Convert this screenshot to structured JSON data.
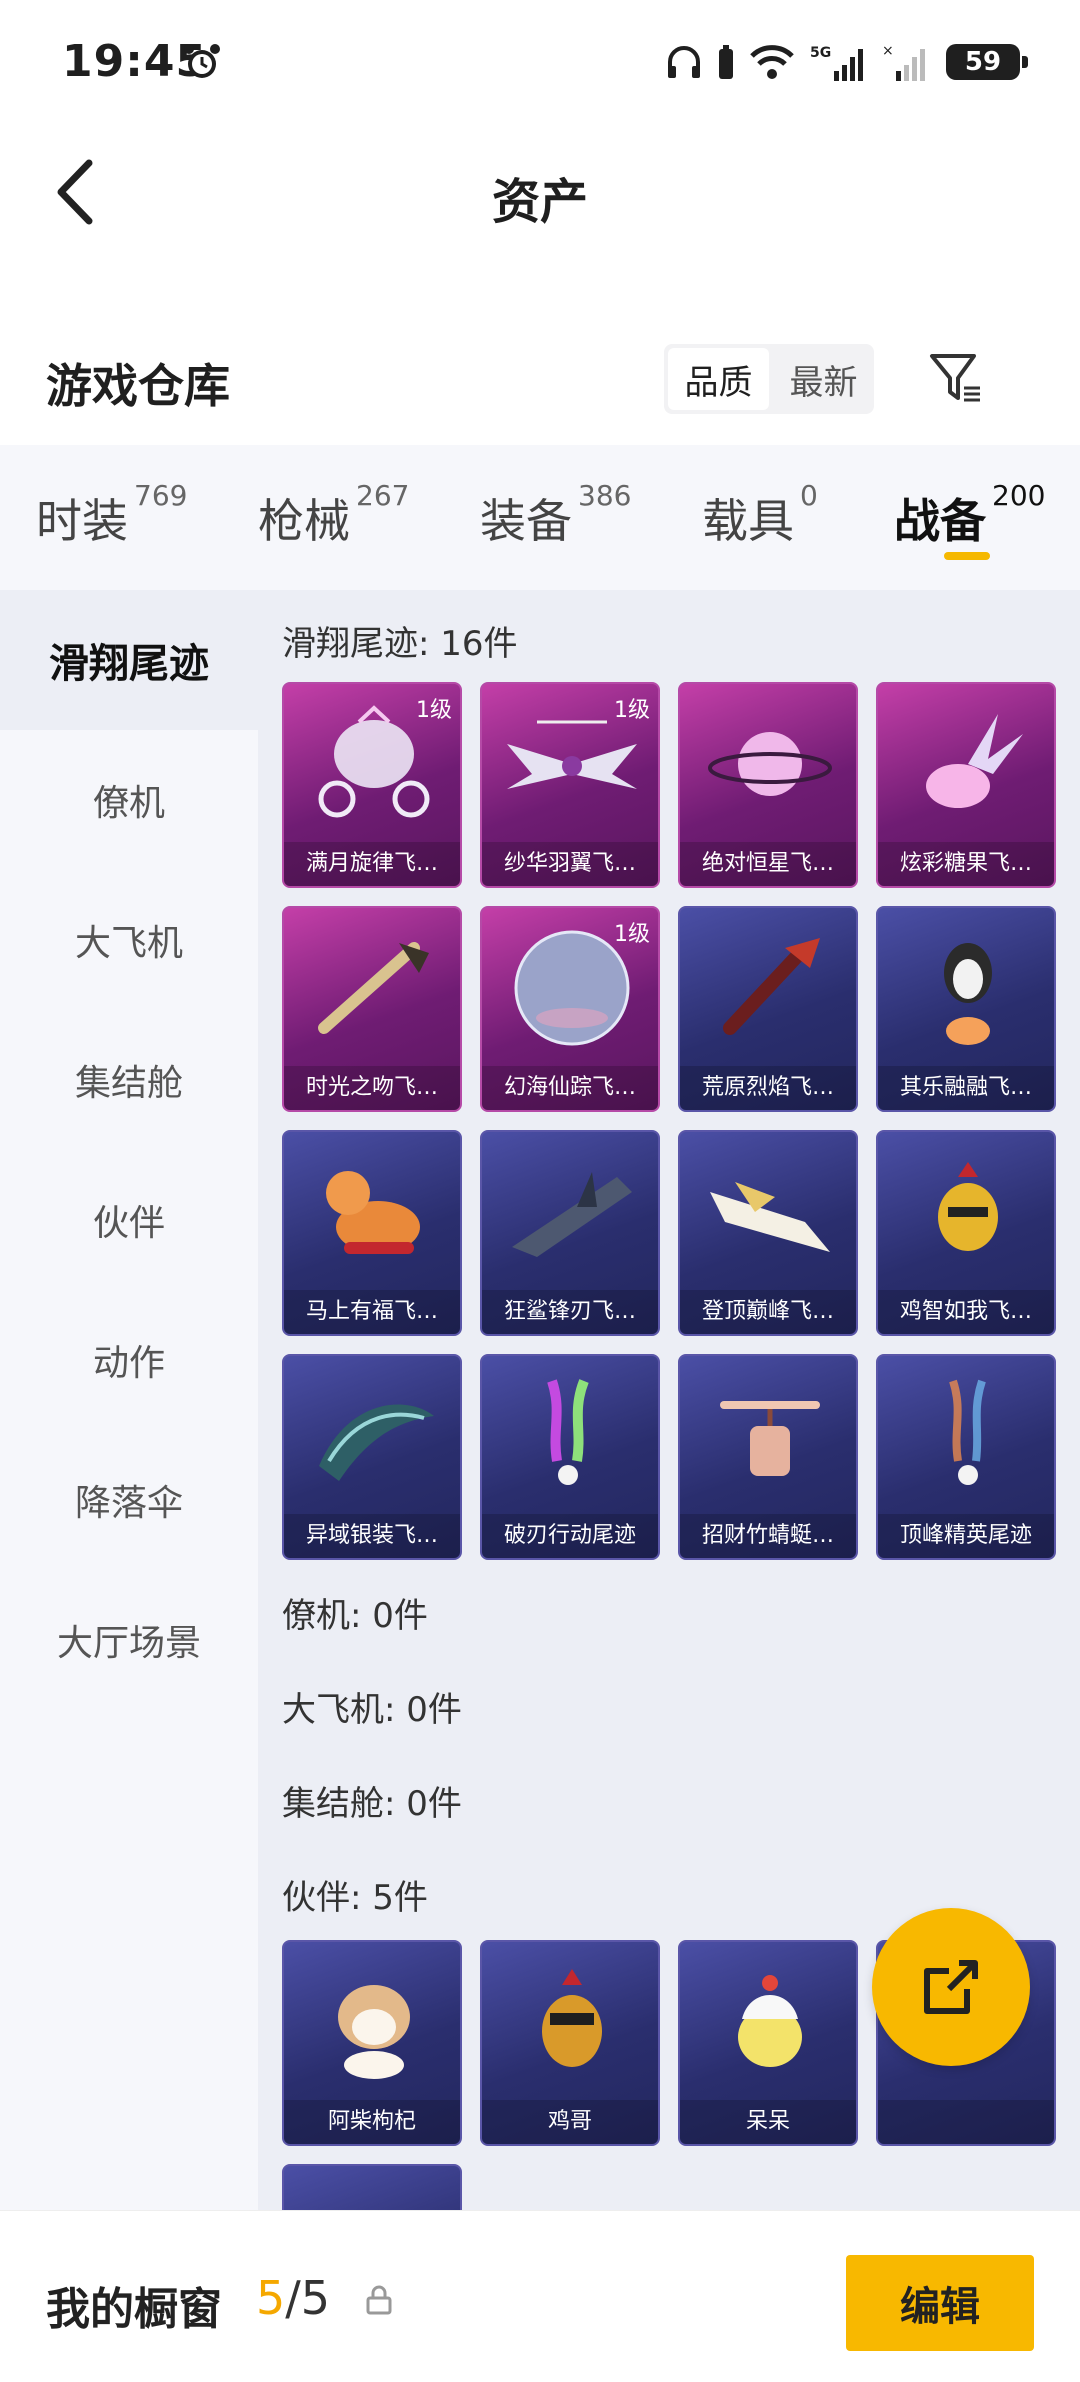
{
  "status": {
    "time": "19:45",
    "battery": "59",
    "network": "5G"
  },
  "nav": {
    "title": "资产"
  },
  "warehouse": {
    "title": "游戏仓库",
    "sort_options": [
      "品质",
      "最新"
    ],
    "selected_sort": "品质"
  },
  "tabs": [
    {
      "label": "时装",
      "count": "769"
    },
    {
      "label": "枪械",
      "count": "267"
    },
    {
      "label": "装备",
      "count": "386"
    },
    {
      "label": "载具",
      "count": "0"
    },
    {
      "label": "战备",
      "count": "200"
    }
  ],
  "active_tab": "战备",
  "sidebar": [
    {
      "label": "滑翔尾迹"
    },
    {
      "label": "僚机"
    },
    {
      "label": "大飞机"
    },
    {
      "label": "集结舱"
    },
    {
      "label": "伙伴"
    },
    {
      "label": "动作"
    },
    {
      "label": "降落伞"
    },
    {
      "label": "大厅场景"
    }
  ],
  "sections": {
    "glide": {
      "title": "滑翔尾迹: 16件",
      "items": [
        {
          "name": "满月旋律飞…",
          "level": "1级",
          "rarity": "purple"
        },
        {
          "name": "纱华羽翼飞…",
          "level": "1级",
          "rarity": "purple"
        },
        {
          "name": "绝对恒星飞…",
          "level": "",
          "rarity": "purple"
        },
        {
          "name": "炫彩糖果飞…",
          "level": "",
          "rarity": "purple"
        },
        {
          "name": "时光之吻飞…",
          "level": "",
          "rarity": "purple"
        },
        {
          "name": "幻海仙踪飞…",
          "level": "1级",
          "rarity": "purple"
        },
        {
          "name": "荒原烈焰飞…",
          "level": "",
          "rarity": "blue"
        },
        {
          "name": "其乐融融飞…",
          "level": "",
          "rarity": "blue"
        },
        {
          "name": "马上有福飞…",
          "level": "",
          "rarity": "blue"
        },
        {
          "name": "狂鲨锋刃飞…",
          "level": "",
          "rarity": "blue"
        },
        {
          "name": "登顶巅峰飞…",
          "level": "",
          "rarity": "blue"
        },
        {
          "name": "鸡智如我飞…",
          "level": "",
          "rarity": "blue"
        },
        {
          "name": "异域银装飞…",
          "level": "",
          "rarity": "blue"
        },
        {
          "name": "破刃行动尾迹",
          "level": "",
          "rarity": "blue"
        },
        {
          "name": "招财竹蜻蜓…",
          "level": "",
          "rarity": "blue"
        },
        {
          "name": "顶峰精英尾迹",
          "level": "",
          "rarity": "blue"
        }
      ]
    },
    "wingman": {
      "title": "僚机: 0件"
    },
    "plane": {
      "title": "大飞机: 0件"
    },
    "capsule": {
      "title": "集结舱: 0件"
    },
    "partner": {
      "title": "伙伴: 5件",
      "items": [
        {
          "name": "阿柴枸杞",
          "rarity": "blue"
        },
        {
          "name": "鸡哥",
          "rarity": "blue"
        },
        {
          "name": "呆呆",
          "rarity": "blue"
        },
        {
          "name": "",
          "rarity": "blue"
        },
        {
          "name": "",
          "rarity": "blue"
        }
      ]
    }
  },
  "bottom": {
    "label": "我的橱窗",
    "current": "5",
    "separator": "/",
    "total": "5",
    "edit_label": "编辑"
  },
  "colors": {
    "accent": "#f8b800",
    "purple_card": "#9b2f93",
    "blue_card": "#2f337a"
  }
}
